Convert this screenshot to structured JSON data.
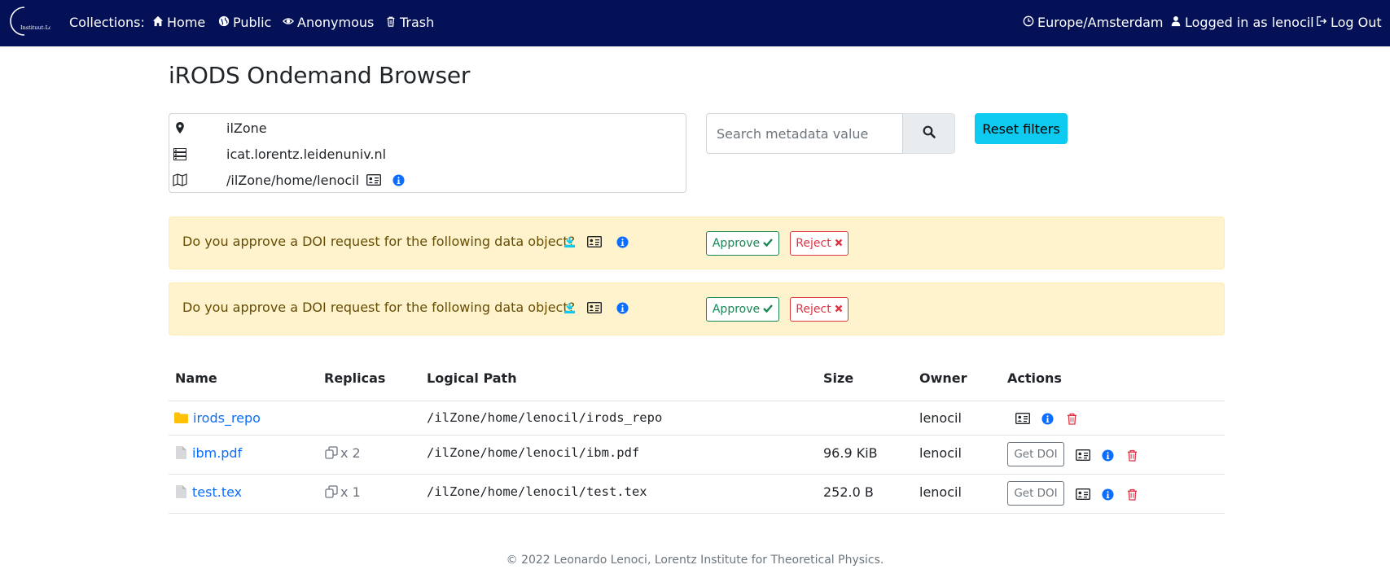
{
  "nav": {
    "logo_text": "Instituut-Lorentz",
    "collections_label": "Collections:",
    "home": "Home",
    "public": "Public",
    "anonymous": "Anonymous",
    "trash": "Trash",
    "timezone": "Europe/Amsterdam",
    "logged_in": "Logged in as lenocil",
    "logout": "Log Out"
  },
  "page": {
    "title": "iRODS Ondemand Browser"
  },
  "info": {
    "zone": "ilZone",
    "host": "icat.lorentz.leidenuniv.nl",
    "path": "/ilZone/home/lenocil"
  },
  "search": {
    "placeholder": "Search metadata value",
    "reset_label": "Reset filters"
  },
  "alerts": [
    {
      "message": "Do you approve a DOI request for the following data object?",
      "approve": "Approve",
      "reject": "Reject"
    },
    {
      "message": "Do you approve a DOI request for the following data object?",
      "approve": "Approve",
      "reject": "Reject"
    }
  ],
  "table": {
    "headers": {
      "name": "Name",
      "replicas": "Replicas",
      "path": "Logical Path",
      "size": "Size",
      "owner": "Owner",
      "actions": "Actions"
    },
    "rows": [
      {
        "type": "folder",
        "name": "irods_repo",
        "replicas": "",
        "path": "/ilZone/home/lenocil/irods_repo",
        "size": "",
        "owner": "lenocil"
      },
      {
        "type": "file",
        "name": "ibm.pdf",
        "replicas": "x 2",
        "path": "/ilZone/home/lenocil/ibm.pdf",
        "size": "96.9 KiB",
        "owner": "lenocil",
        "get_doi": "Get DOI"
      },
      {
        "type": "file",
        "name": "test.tex",
        "replicas": "x 1",
        "path": "/ilZone/home/lenocil/test.tex",
        "size": "252.0 B",
        "owner": "lenocil",
        "get_doi": "Get DOI"
      }
    ]
  },
  "footer": {
    "text": "© 2022 Leonardo Lenoci, Lorentz Institute for Theoretical Physics."
  },
  "colors": {
    "navbar": "#041157",
    "link": "#0d6efd",
    "info_icon": "#0d6efd",
    "download_icon": "#0dcaf0",
    "danger": "#dc3545",
    "success": "#198754",
    "folder": "#ffc107",
    "alert_bg": "#fff3cd"
  },
  "icons": [
    "home-icon",
    "globe-icon",
    "eye-icon",
    "trash-icon",
    "clock-icon",
    "user-icon",
    "logout-icon",
    "map-marker-icon",
    "server-icon",
    "map-icon",
    "id-card-icon",
    "info-icon",
    "download-icon",
    "search-icon",
    "check-icon",
    "times-icon",
    "folder-icon",
    "file-icon",
    "copy-icon"
  ]
}
